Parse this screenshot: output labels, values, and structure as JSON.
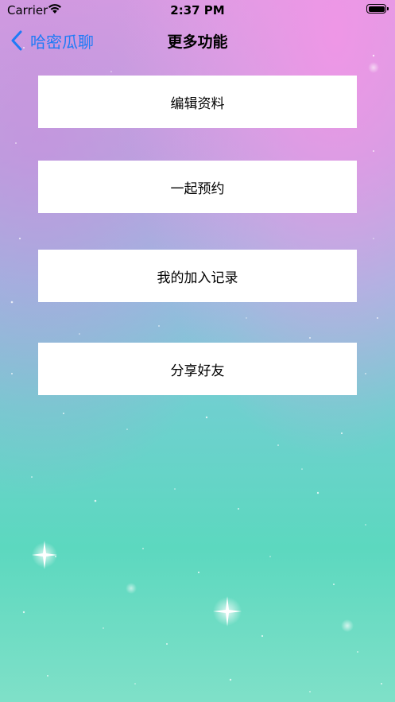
{
  "status_bar": {
    "carrier": "Carrier",
    "time": "2:37 PM",
    "wifi_icon": "wifi-icon",
    "battery_icon": "battery-icon"
  },
  "nav": {
    "back_label": "哈密瓜聊",
    "back_icon": "chevron-left-icon",
    "title": "更多功能",
    "accent_color": "#1f7bf6"
  },
  "menu": {
    "items": [
      {
        "label": "编辑资料"
      },
      {
        "label": "一起预约"
      },
      {
        "label": "我的加入记录"
      },
      {
        "label": "分享好友"
      }
    ]
  }
}
